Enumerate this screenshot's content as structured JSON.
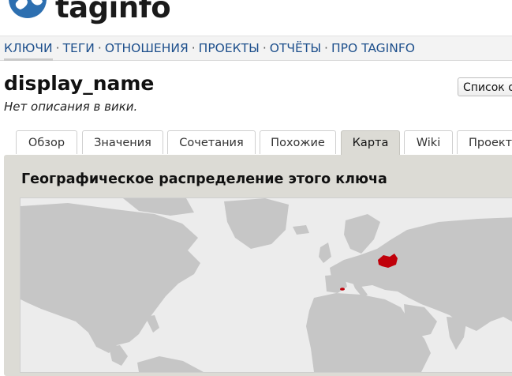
{
  "header": {
    "logo": {
      "text_part1": "tag",
      "text_part2": "info",
      "icon": "globe-icon"
    }
  },
  "nav": {
    "items": [
      {
        "label": "КЛЮЧИ",
        "active": true
      },
      {
        "label": "ТЕГИ"
      },
      {
        "label": "ОТНОШЕНИЯ"
      },
      {
        "label": "ПРОЕКТЫ"
      },
      {
        "label": "ОТЧЁТЫ"
      },
      {
        "label": "ПРО TAGINFO"
      }
    ],
    "separator": "·"
  },
  "page": {
    "title": "display_name",
    "description": "Нет описания в вики.",
    "lang_button": "Список о"
  },
  "tabs": [
    {
      "label": "Обзор"
    },
    {
      "label": "Значения"
    },
    {
      "label": "Сочетания"
    },
    {
      "label": "Похожие"
    },
    {
      "label": "Карта",
      "active": true
    },
    {
      "label": "Wiki"
    },
    {
      "label": "Проект"
    }
  ],
  "panel": {
    "title": "Географическое распределение этого ключа"
  },
  "colors": {
    "nav_link": "#1d4f8c",
    "panel_bg": "#dcdbd5",
    "land": "#c6c6c6",
    "ocean": "#ececec",
    "hotspot": "#c0000a"
  }
}
